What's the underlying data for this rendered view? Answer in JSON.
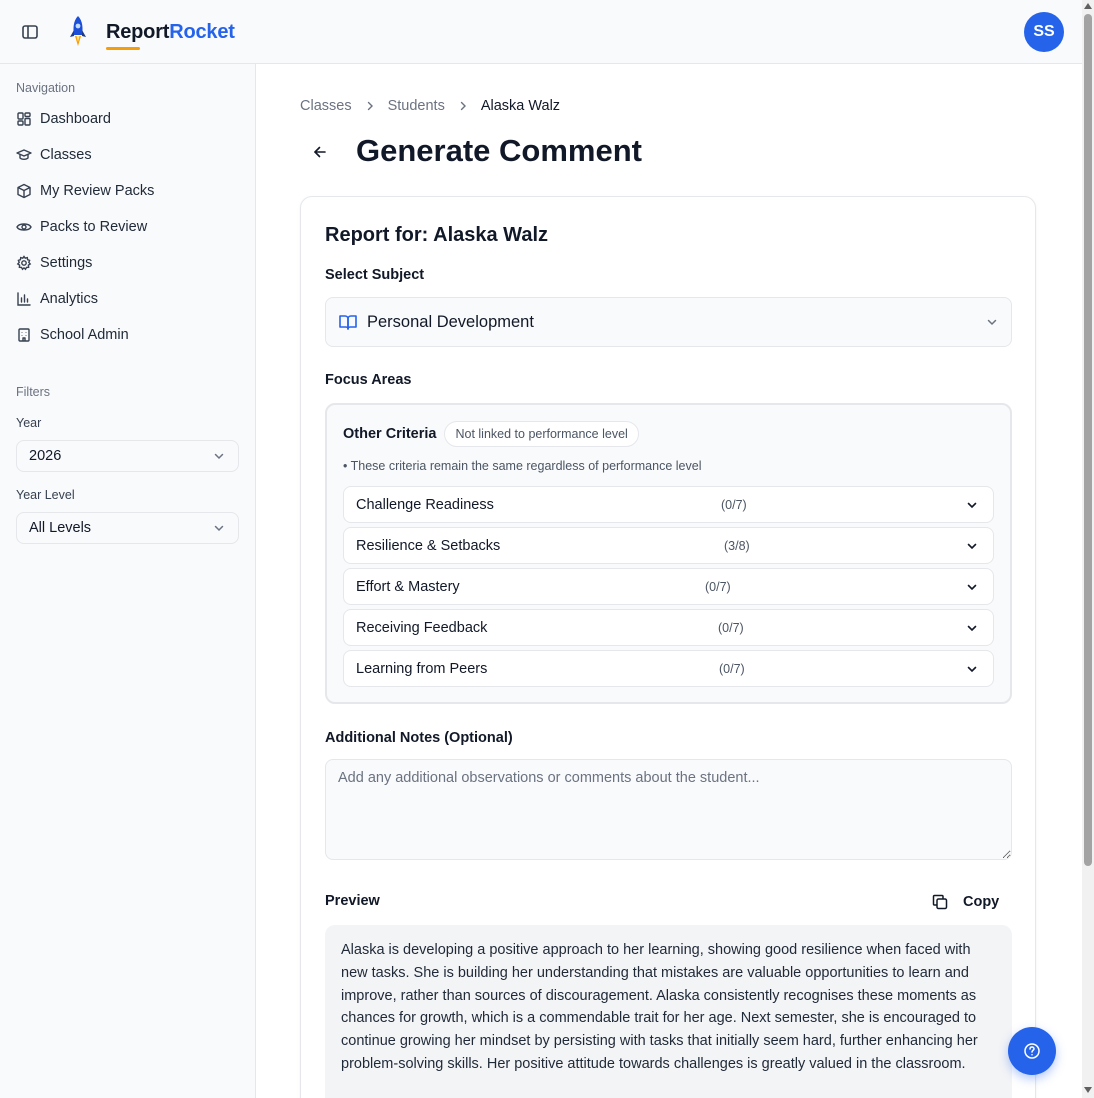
{
  "app": {
    "brand_part1": "Report",
    "brand_part2": "Rocket",
    "user_initials": "SS",
    "accent_color": "#2563eb",
    "underline_color": "#f59e0b"
  },
  "sidebar": {
    "nav_heading": "Navigation",
    "items": [
      {
        "label": "Dashboard",
        "icon": "dashboard-icon"
      },
      {
        "label": "Classes",
        "icon": "graduation-cap-icon"
      },
      {
        "label": "My Review Packs",
        "icon": "package-icon"
      },
      {
        "label": "Packs to Review",
        "icon": "eye-icon"
      },
      {
        "label": "Settings",
        "icon": "gear-icon"
      },
      {
        "label": "Analytics",
        "icon": "bar-chart-icon"
      },
      {
        "label": "School Admin",
        "icon": "building-icon"
      }
    ],
    "filters_heading": "Filters",
    "year_label": "Year",
    "year_value": "2026",
    "year_level_label": "Year Level",
    "year_level_value": "All Levels"
  },
  "breadcrumb": {
    "items": [
      "Classes",
      "Students",
      "Alaska Walz"
    ]
  },
  "page": {
    "title": "Generate Comment"
  },
  "report": {
    "title": "Report for: Alaska Walz",
    "subject_label": "Select Subject",
    "subject_value": "Personal Development",
    "focus_label": "Focus Areas",
    "criteria_title": "Other Criteria",
    "criteria_badge": "Not linked to performance level",
    "criteria_note": "• These criteria remain the same regardless of performance level",
    "criteria": [
      {
        "label": "Challenge Readiness",
        "count": "(0/7)"
      },
      {
        "label": "Resilience & Setbacks",
        "count": "(3/8)"
      },
      {
        "label": "Effort & Mastery",
        "count": "(0/7)"
      },
      {
        "label": "Receiving Feedback",
        "count": "(0/7)"
      },
      {
        "label": "Learning from Peers",
        "count": "(0/7)"
      }
    ],
    "notes_label": "Additional Notes (Optional)",
    "notes_placeholder": "Add any additional observations or comments about the student...",
    "notes_value": "",
    "preview_label": "Preview",
    "copy_label": "Copy",
    "preview_text": "Alaska is developing a positive approach to her learning, showing good resilience when faced with new tasks. She is building her understanding that mistakes are valuable opportunities to learn and improve, rather than sources of discouragement. Alaska consistently recognises these moments as chances for growth, which is a commendable trait for her age. Next semester, she is encouraged to continue growing her mindset by persisting with tasks that initially seem hard, further enhancing her problem-solving skills. Her positive attitude towards challenges is greatly valued in the classroom."
  }
}
